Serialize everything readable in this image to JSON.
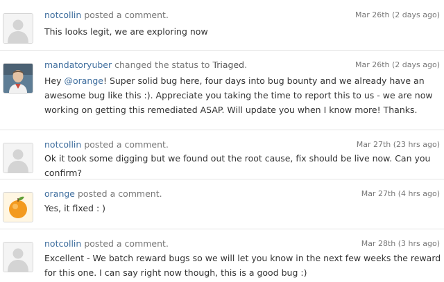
{
  "activity": [
    {
      "user": "notcollin",
      "action": "posted a comment.",
      "timestamp": "Mar 26th (2 days ago)",
      "avatar": "default-avatar-icon",
      "text": "This looks legit, we are exploring now"
    },
    {
      "user": "mandatoryuber",
      "action": "changed the status to",
      "status": "Triaged",
      "timestamp": "Mar 26th (2 days ago)",
      "avatar": "mandatoryuber-photo",
      "text_before": "Hey ",
      "mention": "@orange",
      "text_after": "! Super solid bug here, four days into bug bounty and we already have an awesome bug like this :). Appreciate you taking the time to report this to us - we are now working on getting this remediated ASAP. Will update you when I know more! Thanks."
    },
    {
      "user": "notcollin",
      "action": "posted a comment.",
      "timestamp": "Mar 27th (23 hrs ago)",
      "avatar": "default-avatar-icon",
      "text": "Ok it took some digging but we found out the root cause, fix should be live now. Can you confirm?"
    },
    {
      "user": "orange",
      "action": "posted a comment.",
      "timestamp": "Mar 27th (4 hrs ago)",
      "avatar": "orange-fruit-icon",
      "text": "Yes, it fixed : )"
    },
    {
      "user": "notcollin",
      "action": "posted a comment.",
      "timestamp": "Mar 28th (3 hrs ago)",
      "avatar": "default-avatar-icon",
      "text": "Excellent - We batch reward bugs so we will let you know in the next few weeks the reward for this one. I can say right now though, this is a good bug :)"
    }
  ]
}
